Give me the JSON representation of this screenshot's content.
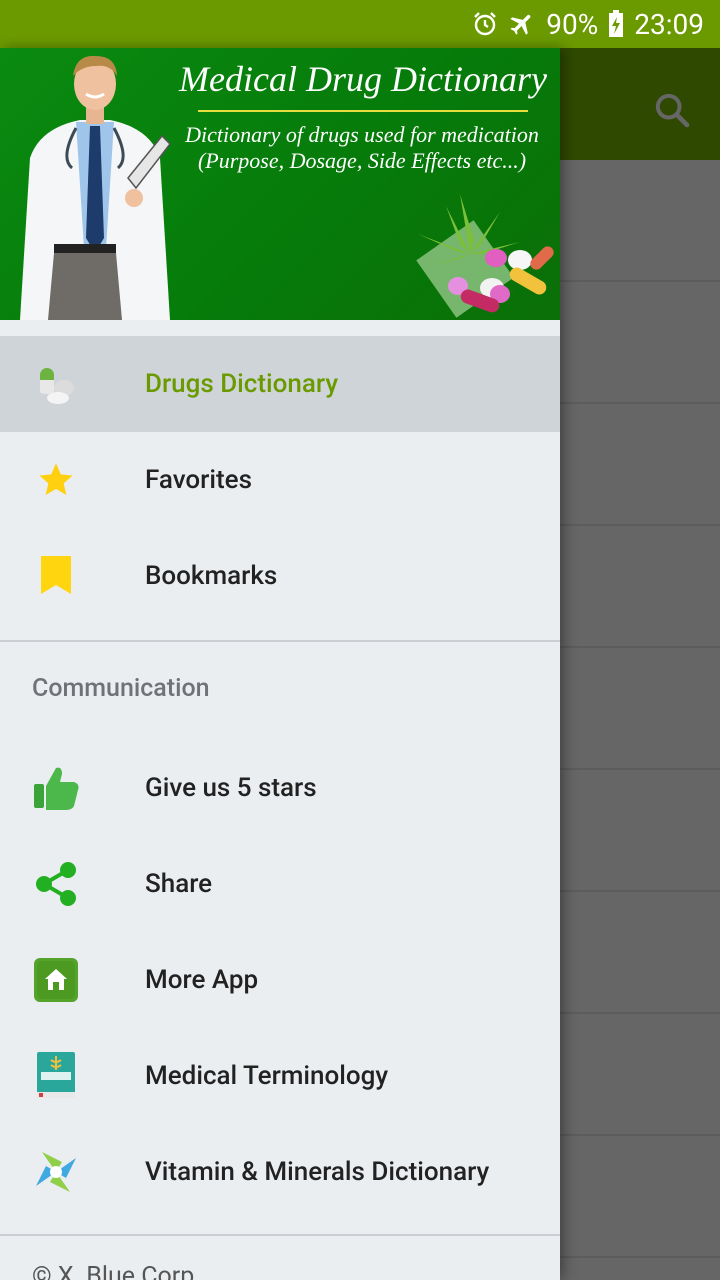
{
  "status_bar": {
    "battery": "90%",
    "time": "23:09",
    "icons": [
      "alarm-icon",
      "airplane-icon",
      "battery-charging-icon"
    ]
  },
  "app": {
    "search_icon": "search-icon"
  },
  "drawer": {
    "header": {
      "title": "Medical Drug Dictionary",
      "subtitle_line1": "Dictionary of drugs used for medication",
      "subtitle_line2": "(Purpose, Dosage, Side Effects etc...)"
    },
    "items": [
      {
        "label": "Drugs Dictionary",
        "icon": "pills-icon",
        "active": true
      },
      {
        "label": "Favorites",
        "icon": "star-icon"
      },
      {
        "label": "Bookmarks",
        "icon": "bookmark-icon"
      }
    ],
    "section_title": "Communication",
    "communication_items": [
      {
        "label": "Give us 5 stars",
        "icon": "thumbs-up-icon"
      },
      {
        "label": "Share",
        "icon": "share-icon"
      },
      {
        "label": "More App",
        "icon": "home-icon"
      },
      {
        "label": "Medical Terminology",
        "icon": "medical-book-icon"
      },
      {
        "label": "Vitamin & Minerals Dictionary",
        "icon": "vitamin-icon"
      }
    ],
    "footer": "© X. Blue Corp"
  },
  "colors": {
    "accent": "#6b9a00",
    "toolbar_dark": "#2f4a00",
    "drawer_bg": "#ebeef1",
    "active_bg": "#cfd4d9"
  }
}
